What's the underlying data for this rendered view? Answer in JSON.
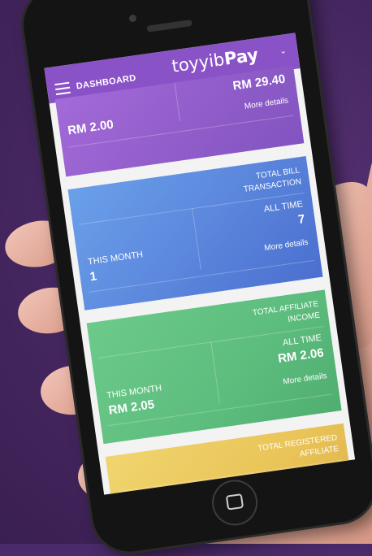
{
  "header": {
    "title": "DASHBOARD",
    "logo_prefix": "toyyib",
    "logo_suffix": "Pay"
  },
  "cards": {
    "purchase": {
      "this_month_value": "RM 2.00",
      "all_time_value": "RM 29.40",
      "more_link": "More details"
    },
    "bill_transaction": {
      "title_line1": "TOTAL BILL",
      "title_line2": "TRANSACTION",
      "this_month_label": "THIS MONTH",
      "this_month_value": "1",
      "all_time_label": "ALL TIME",
      "all_time_value": "7",
      "more_link": "More details"
    },
    "affiliate_income": {
      "title_line1": "TOTAL AFFILIATE",
      "title_line2": "INCOME",
      "this_month_label": "THIS MONTH",
      "this_month_value": "RM 2.05",
      "all_time_label": "ALL TIME",
      "all_time_value": "RM 2.06",
      "more_link": "More details"
    },
    "registered_affiliate": {
      "title_line1": "TOTAL REGISTERED",
      "title_line2": "AFFILIATE"
    }
  },
  "colors": {
    "purple_card": "#9a62d2",
    "blue_card": "#5c88dd",
    "green_card": "#5dbd7e",
    "gold_card": "#e9c458",
    "background": "#4a2a6a"
  }
}
